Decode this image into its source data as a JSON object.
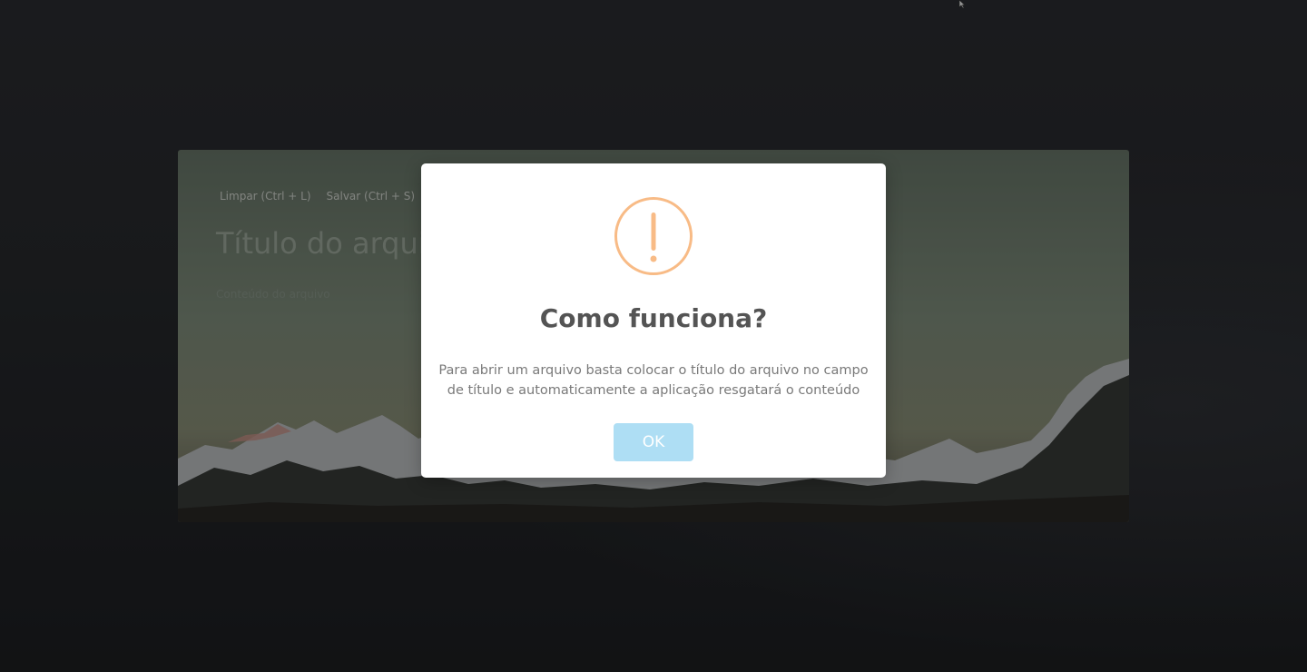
{
  "editor": {
    "toolbar": {
      "clear_label": "Limpar (Ctrl + L)",
      "save_label": "Salvar (Ctrl + S)"
    },
    "title_placeholder": "Título do arquivo",
    "content_placeholder": "Conteúdo do arquivo"
  },
  "modal": {
    "icon": "warning-icon",
    "title": "Como funciona?",
    "message": "Para abrir um arquivo basta colocar o título do arquivo no campo de título e automaticamente a aplicação resgatará o conteúdo",
    "ok_label": "OK"
  },
  "colors": {
    "warning": "#f8bb86",
    "ok_button": "#aedef4",
    "title_text": "#545454",
    "message_text": "#797979"
  }
}
